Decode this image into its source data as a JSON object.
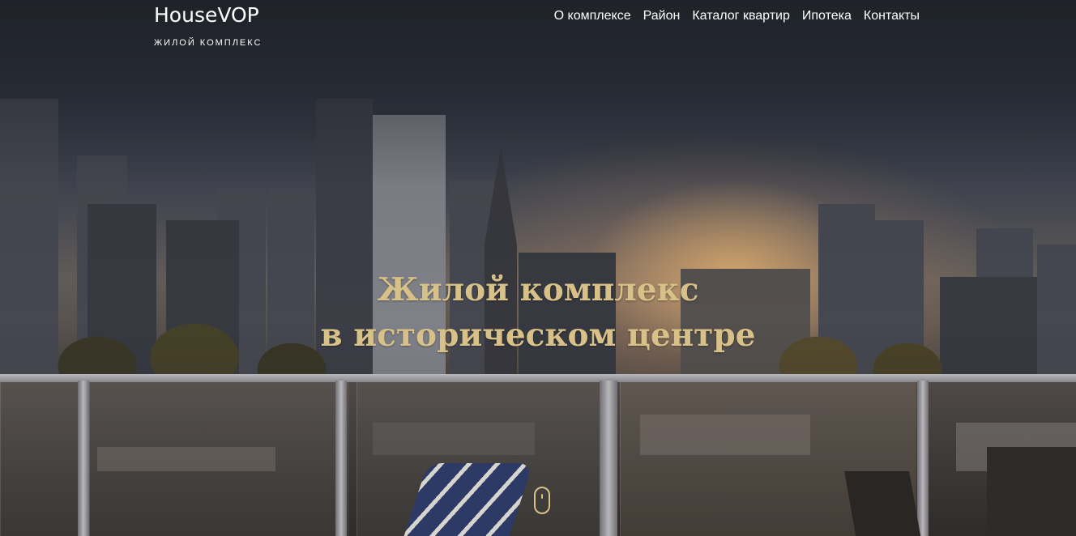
{
  "brand": {
    "name": "HouseVOP",
    "tagline": "ЖИЛОЙ КОМПЛЕКС"
  },
  "nav": {
    "items": [
      {
        "label": "О комплексе"
      },
      {
        "label": "Район"
      },
      {
        "label": "Каталог квартир"
      },
      {
        "label": "Ипотека"
      },
      {
        "label": "Контакты"
      }
    ]
  },
  "hero": {
    "headline_line1": "Жилой комплекс",
    "headline_line2": "в историческом центре",
    "scroll_icon": "mouse-scroll-icon"
  },
  "colors": {
    "accent_gold": "#d7c188",
    "nav_text": "#ffffff",
    "header_bg": "#262a32"
  }
}
